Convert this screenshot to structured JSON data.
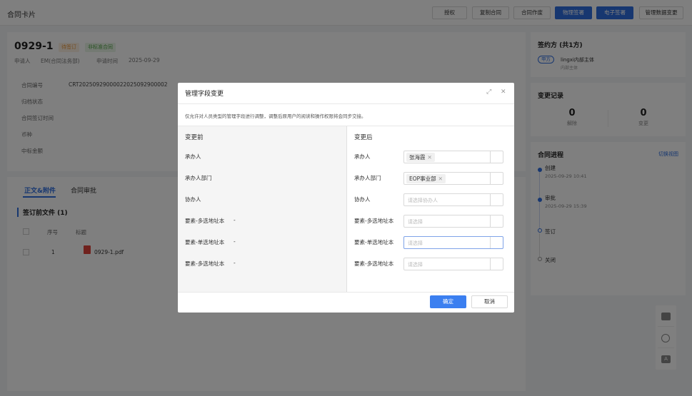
{
  "header": {
    "title": "合同卡片",
    "buttons": [
      "授权",
      "复制合同",
      "合同作废",
      "物理签署",
      "电子签署",
      "管理数据变更"
    ]
  },
  "contract": {
    "number": "0929-1",
    "status_tag": "待签订",
    "type_tag": "非标准合同",
    "applicant_label": "申请人",
    "applicant": "EM(合同法务部)",
    "apply_time_label": "申请时间",
    "apply_time": "2025-09-29",
    "fields": [
      {
        "label": "合同编号",
        "value": "CRT20250929000022025092900002"
      },
      {
        "label": "归档状态",
        "value": ""
      },
      {
        "label": "合同签订时间",
        "value": ""
      },
      {
        "label": "币种",
        "value": ""
      },
      {
        "label": "中标金额",
        "value": ""
      }
    ]
  },
  "tabs": [
    "正文&附件",
    "合同审批"
  ],
  "files": {
    "section_title": "签订前文件 (1)",
    "columns": [
      "序号",
      "标题"
    ],
    "rows": [
      {
        "index": "1",
        "title": "0929-1.pdf"
      }
    ]
  },
  "signers": {
    "title": "签约方 (共1方)",
    "party_tag": "甲方",
    "party_name": "lingxi内部主体",
    "party_sub": "内部主体"
  },
  "changes": {
    "title": "变更记录",
    "stats": [
      {
        "num": "0",
        "label": "解除"
      },
      {
        "num": "0",
        "label": "变更"
      }
    ]
  },
  "progress": {
    "title": "合同进程",
    "switch_link": "切换视图",
    "steps": [
      {
        "label": "创建",
        "time": "2025-09-29 10:41"
      },
      {
        "label": "审批",
        "time": "2025-09-29 15:39"
      },
      {
        "label": "签订",
        "time": ""
      },
      {
        "label": "关闭",
        "time": ""
      }
    ]
  },
  "modal": {
    "title": "管理字段变更",
    "description": "仅允许对人员类型的管理字段进行调整，调整后原用户的阅读和操作权限将会同步交接。",
    "before_header": "变更前",
    "after_header": "变更后",
    "before_rows": [
      {
        "label": "承办人",
        "value": ""
      },
      {
        "label": "承办人部门",
        "value": ""
      },
      {
        "label": "协办人",
        "value": ""
      },
      {
        "label": "要素-多选地址本",
        "value": "-"
      },
      {
        "label": "要素-单选地址本",
        "value": "-"
      },
      {
        "label": "要素-多选地址本",
        "value": "-"
      }
    ],
    "after_rows": [
      {
        "label": "承办人",
        "chip": "张海霞",
        "placeholder": ""
      },
      {
        "label": "承办人部门",
        "chip": "EOP事业部",
        "placeholder": ""
      },
      {
        "label": "协办人",
        "chip": "",
        "placeholder": "请选择协办人"
      },
      {
        "label": "要素-多选地址本",
        "chip": "",
        "placeholder": "请选择"
      },
      {
        "label": "要素-单选地址本",
        "chip": "",
        "placeholder": "请选择"
      },
      {
        "label": "要素-多选地址本",
        "chip": "",
        "placeholder": "请选择"
      }
    ],
    "confirm_label": "确定",
    "cancel_label": "取消"
  },
  "colors": {
    "primary": "#2f6fe0",
    "confirm": "#3b7ff0",
    "overlay": "rgba(0,0,0,0.5)"
  }
}
